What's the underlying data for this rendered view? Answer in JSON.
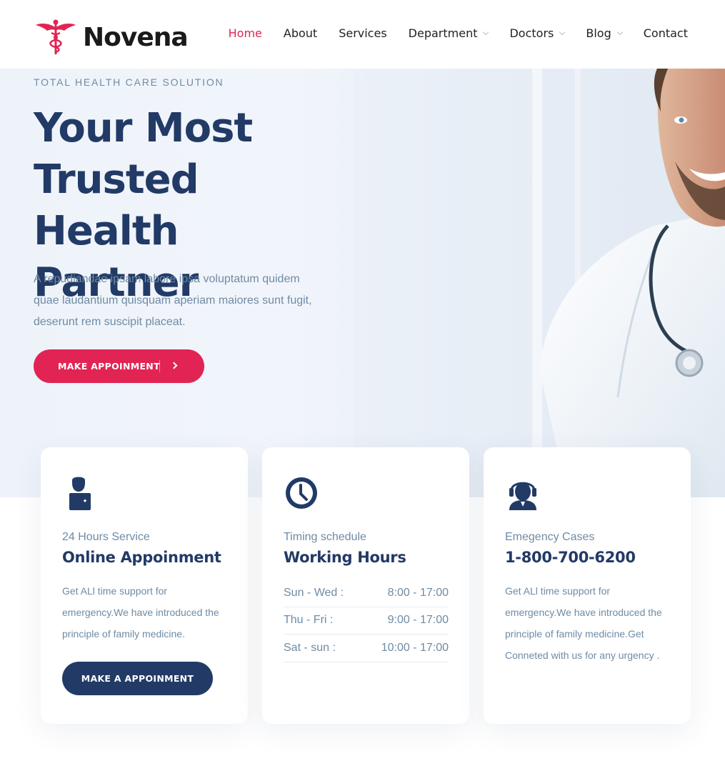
{
  "brand": {
    "name": "Novena",
    "accent": "#e12454",
    "primary": "#223a66"
  },
  "nav": {
    "items": [
      {
        "label": "Home",
        "active": true,
        "dropdown": false
      },
      {
        "label": "About",
        "active": false,
        "dropdown": false
      },
      {
        "label": "Services",
        "active": false,
        "dropdown": false
      },
      {
        "label": "Department",
        "active": false,
        "dropdown": true
      },
      {
        "label": "Doctors",
        "active": false,
        "dropdown": true
      },
      {
        "label": "Blog",
        "active": false,
        "dropdown": true
      },
      {
        "label": "Contact",
        "active": false,
        "dropdown": false
      }
    ]
  },
  "hero": {
    "subtitle": "TOTAL HEALTH CARE SOLUTION",
    "title": "Your Most Trusted Health Partner",
    "description": "A repudiandae ipsam labore ipsa voluptatum quidem quae laudantium quisquam aperiam maiores sunt fugit, deserunt rem suscipit placeat.",
    "button_label": "MAKE APPOINMENT"
  },
  "cards": {
    "appointment": {
      "icon": "doctor-icon",
      "kicker": "24 Hours Service",
      "title": "Online Appoinment",
      "text": "Get ALl time support for emergency.We have introduced the principle of family medicine.",
      "button_label": "MAKE A APPOINMENT"
    },
    "hours": {
      "icon": "clock-icon",
      "kicker": "Timing schedule",
      "title": "Working Hours",
      "rows": [
        {
          "day": "Sun - Wed :",
          "time": "8:00 - 17:00"
        },
        {
          "day": "Thu - Fri :",
          "time": "9:00 - 17:00"
        },
        {
          "day": "Sat - sun :",
          "time": "10:00 - 17:00"
        }
      ]
    },
    "emergency": {
      "icon": "headset-icon",
      "kicker": "Emegency Cases",
      "title": "1-800-700-6200",
      "text": "Get ALl time support for emergency.We have introduced the principle of family medicine.Get Conneted with us for any urgency ."
    }
  }
}
